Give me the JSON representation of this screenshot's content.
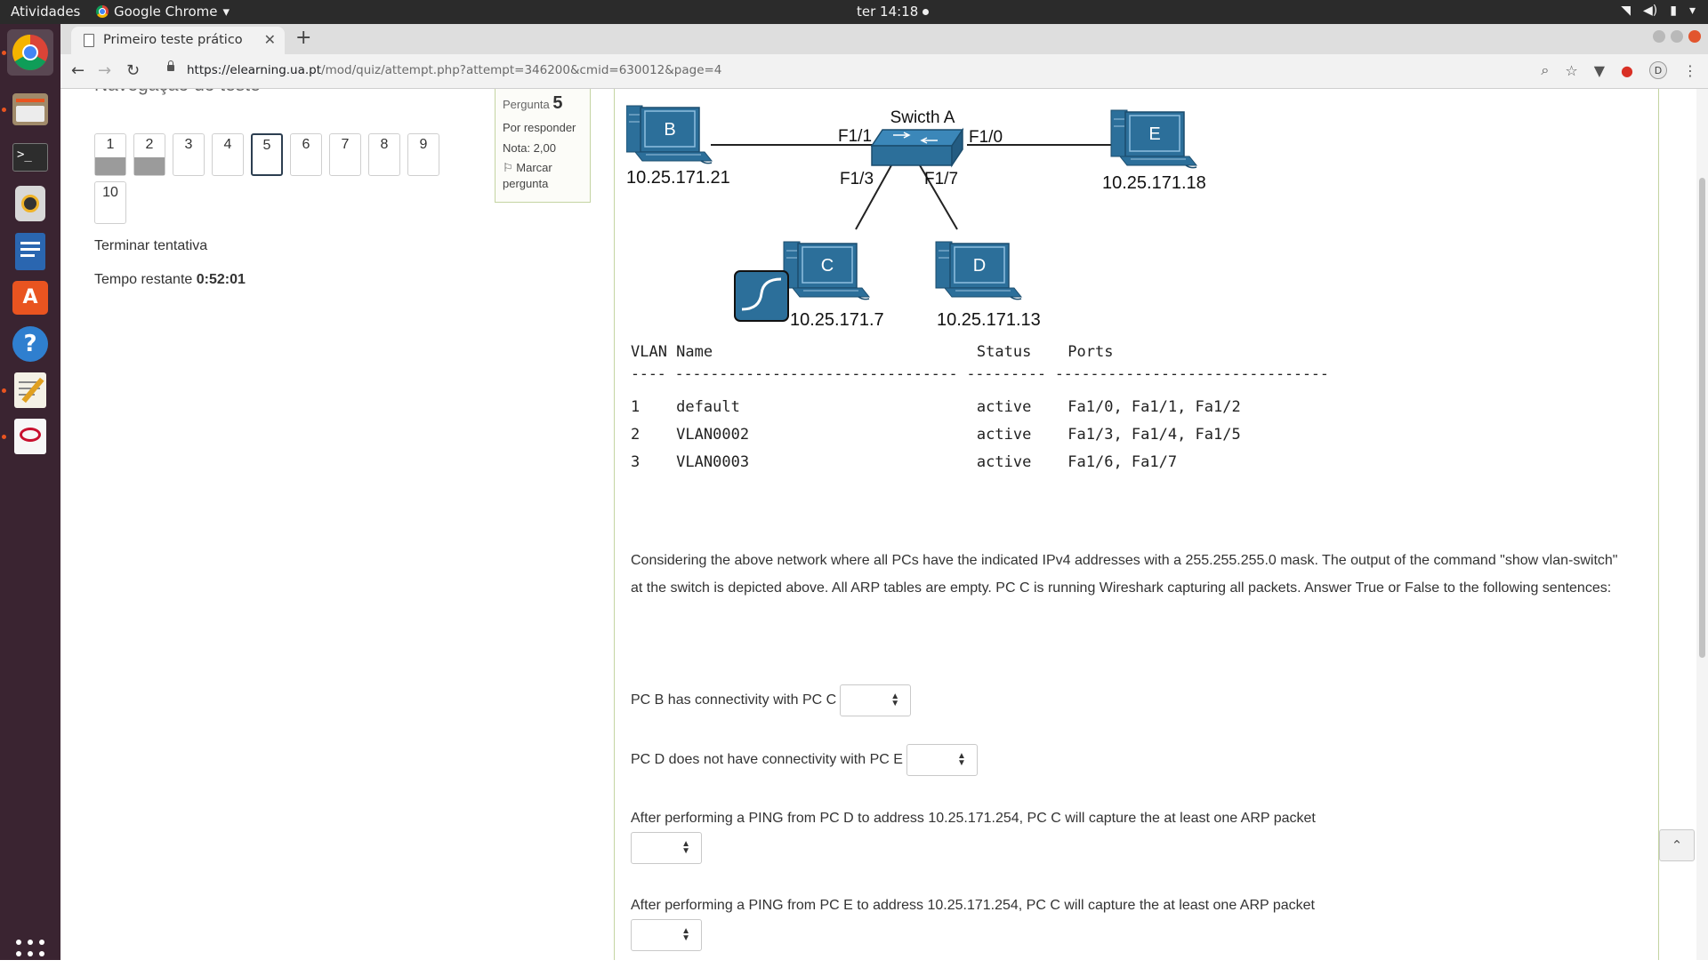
{
  "system": {
    "activities": "Atividades",
    "app_name": "Google Chrome",
    "clock": "ter 14:18"
  },
  "browser": {
    "tab_title": "Primeiro teste prático",
    "url_host": "https://elearning.ua.pt",
    "url_path": "/mod/quiz/attempt.php?attempt=346200&cmid=630012&page=4",
    "profile_initial": "D"
  },
  "quiz_nav": {
    "title": "Navegação do teste",
    "buttons": [
      {
        "label": "1",
        "state": "answered"
      },
      {
        "label": "2",
        "state": "answered"
      },
      {
        "label": "3",
        "state": "unanswered"
      },
      {
        "label": "4",
        "state": "unanswered"
      },
      {
        "label": "5",
        "state": "current"
      },
      {
        "label": "6",
        "state": "unanswered"
      },
      {
        "label": "7",
        "state": "unanswered"
      },
      {
        "label": "8",
        "state": "unanswered"
      },
      {
        "label": "9",
        "state": "unanswered"
      },
      {
        "label": "10",
        "state": "unanswered"
      }
    ],
    "finish_attempt": "Terminar tentativa",
    "time_left_label": "Tempo restante",
    "time_left_value": "0:52:01"
  },
  "question_info": {
    "label": "Pergunta",
    "number": "5",
    "status": "Por responder",
    "grade": "Nota: 2,00",
    "flag": "Marcar pergunta"
  },
  "diagram": {
    "switch_label": "Swicth A",
    "port_f11": "F1/1",
    "port_f10": "F1/0",
    "port_f13": "F1/3",
    "port_f17": "F1/7",
    "pc_b": {
      "letter": "B",
      "ip": "10.25.171.21"
    },
    "pc_e": {
      "letter": "E",
      "ip": "10.25.171.18"
    },
    "pc_c": {
      "letter": "C",
      "ip": "10.25.171.7"
    },
    "pc_d": {
      "letter": "D",
      "ip": "10.25.171.13"
    }
  },
  "vlan_table": {
    "header": "VLAN Name                             Status    Ports",
    "separator": "---- -------------------------------- --------- -------------------------------",
    "rows": [
      "1    default                          active    Fa1/0, Fa1/1, Fa1/2",
      "2    VLAN0002                         active    Fa1/3, Fa1/4, Fa1/5",
      "3    VLAN0003                         active    Fa1/6, Fa1/7"
    ]
  },
  "question": {
    "text": "Considering the above network where all PCs have the indicated IPv4 addresses with a 255.255.255.0 mask. The output of the command \"show vlan-switch\" at the switch is depicted above. All ARP tables are empty. PC C is running Wireshark capturing all packets. Answer True or False to the following sentences:",
    "statements": [
      "PC B has connectivity with PC C",
      "PC D does not have connectivity with PC E",
      "After performing a PING from PC D to address 10.25.171.254, PC C will capture the at least one ARP packet",
      "After performing a PING from PC E to address 10.25.171.254, PC C will capture the at least one ARP packet"
    ]
  },
  "colors": {
    "device_blue": "#2c6f9a",
    "panel_border": "#c4d4a2",
    "dock_bg": "#3a2431"
  }
}
